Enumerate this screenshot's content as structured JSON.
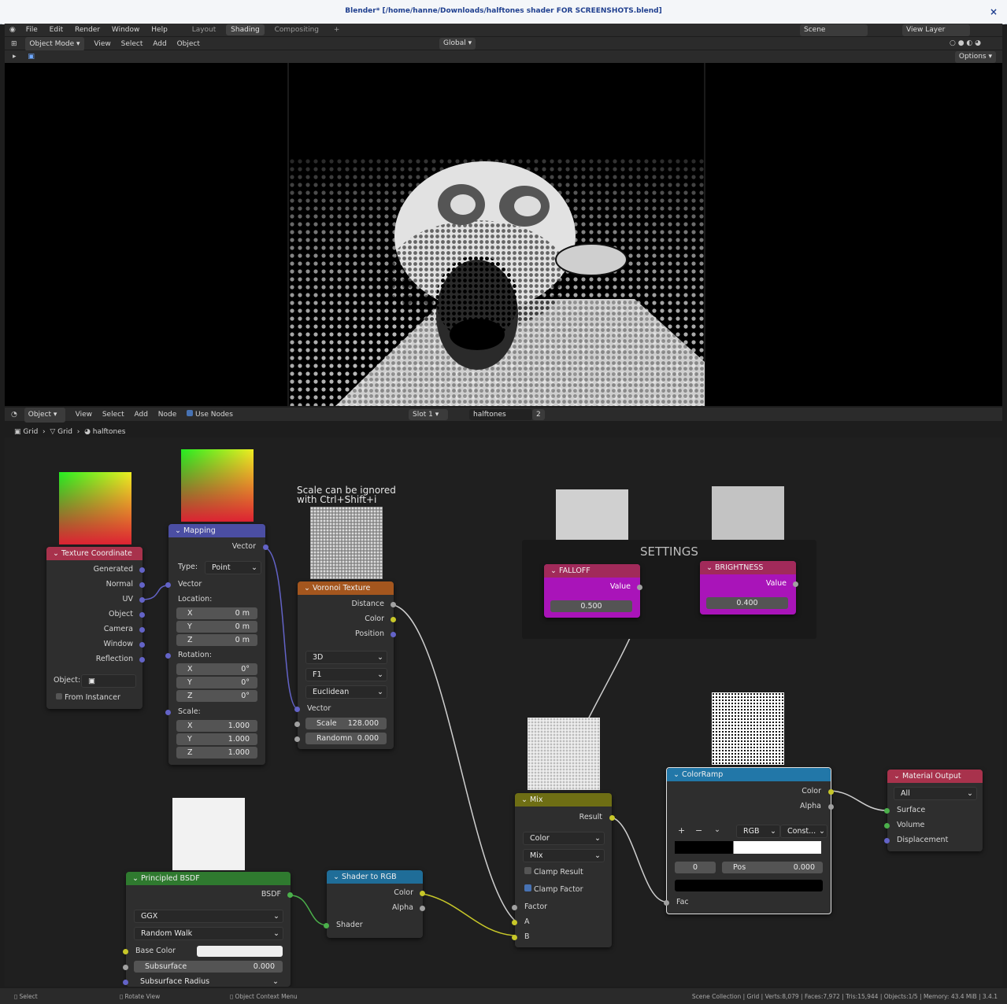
{
  "window": {
    "title": "Blender* [/home/hanne/Downloads/halftones shader FOR SCREENSHOTS.blend]",
    "close": "×"
  },
  "topbar": {
    "menus": [
      "File",
      "Edit",
      "Render",
      "Window",
      "Help"
    ],
    "tabs": [
      "Layout",
      "Shading",
      "Compositing"
    ],
    "add_tab": "+",
    "scene": "Scene",
    "view_layer": "View Layer"
  },
  "viewport_header": {
    "mode": "Object Mode",
    "menus": [
      "View",
      "Select",
      "Add",
      "Object"
    ],
    "orientation": "Global",
    "options": "Options"
  },
  "node_header": {
    "type": "Object",
    "menus": [
      "View",
      "Select",
      "Add",
      "Node"
    ],
    "use_nodes": "Use Nodes",
    "slot": "Slot 1",
    "material": "halftones",
    "users": "2"
  },
  "breadcrumb": [
    "Grid",
    "Grid",
    "halftones"
  ],
  "nodes": {
    "texcoord": {
      "title": "Texture Coordinate",
      "outputs": [
        "Generated",
        "Normal",
        "UV",
        "Object",
        "Camera",
        "Window",
        "Reflection"
      ],
      "object_label": "Object:",
      "from_instancer": "From Instancer"
    },
    "mapping": {
      "title": "Mapping",
      "out": "Vector",
      "type_label": "Type:",
      "type_value": "Point",
      "vector": "Vector",
      "location": "Location:",
      "loc": [
        [
          "X",
          "0 m"
        ],
        [
          "Y",
          "0 m"
        ],
        [
          "Z",
          "0 m"
        ]
      ],
      "rotation": "Rotation:",
      "rot": [
        [
          "X",
          "0°"
        ],
        [
          "Y",
          "0°"
        ],
        [
          "Z",
          "0°"
        ]
      ],
      "scale_label": "Scale:",
      "scale": [
        [
          "X",
          "1.000"
        ],
        [
          "Y",
          "1.000"
        ],
        [
          "Z",
          "1.000"
        ]
      ]
    },
    "voronoi": {
      "title": "Voronoi Texture",
      "outputs": [
        "Distance",
        "Color",
        "Position"
      ],
      "dims": "3D",
      "feature": "F1",
      "metric": "Euclidean",
      "vector": "Vector",
      "scale_label": "Scale",
      "scale": "128.000",
      "random_label": "Randomn",
      "random": "0.000"
    },
    "frame": {
      "label": "SETTINGS"
    },
    "falloff": {
      "title": "FALLOFF",
      "out": "Value",
      "value": "0.500"
    },
    "brightness": {
      "title": "BRIGHTNESS",
      "out": "Value",
      "value": "0.400"
    },
    "mix": {
      "title": "Mix",
      "out": "Result",
      "data_type": "Color",
      "blend": "Mix",
      "clamp_result": "Clamp Result",
      "clamp_factor": "Clamp Factor",
      "factor": "Factor",
      "a": "A",
      "b": "B"
    },
    "colorramp": {
      "title": "ColorRamp",
      "outputs": [
        "Color",
        "Alpha"
      ],
      "color_mode": "RGB",
      "interp": "Const...",
      "index": "0",
      "pos_label": "Pos",
      "pos": "0.000",
      "fac": "Fac"
    },
    "output": {
      "title": "Material Output",
      "target": "All",
      "inputs": [
        "Surface",
        "Volume",
        "Displacement"
      ]
    },
    "bsdf": {
      "title": "Principled BSDF",
      "out": "BSDF",
      "distribution": "GGX",
      "sss_method": "Random Walk",
      "base_color": "Base Color",
      "subsurface": "Subsurface",
      "subsurface_value": "0.000",
      "subsurface_radius": "Subsurface Radius"
    },
    "shader2rgb": {
      "title": "Shader to RGB",
      "outputs": [
        "Color",
        "Alpha"
      ],
      "input": "Shader"
    }
  },
  "annotation": "Scale can be ignored\nwith Ctrl+Shift+i",
  "statusbar": {
    "left": [
      "Select",
      "Rotate View",
      "Object Context Menu"
    ],
    "right": "Scene Collection | Grid | Verts:8,079 | Faces:7,972 | Tris:15,944 | Objects:1/5 | Memory: 43.4 MiB | 3.4.1"
  },
  "colors": {
    "texcoord": "#a8324c",
    "mapping": "#4b4ea3",
    "voronoi": "#a4561e",
    "value": "#a12a5a",
    "value_body": "#a914b9",
    "mix": "#6e6e14",
    "colorramp": "#2277a8",
    "output": "#a8324c",
    "bsdf": "#2f7a2f",
    "shader2rgb": "#1f6d98"
  }
}
